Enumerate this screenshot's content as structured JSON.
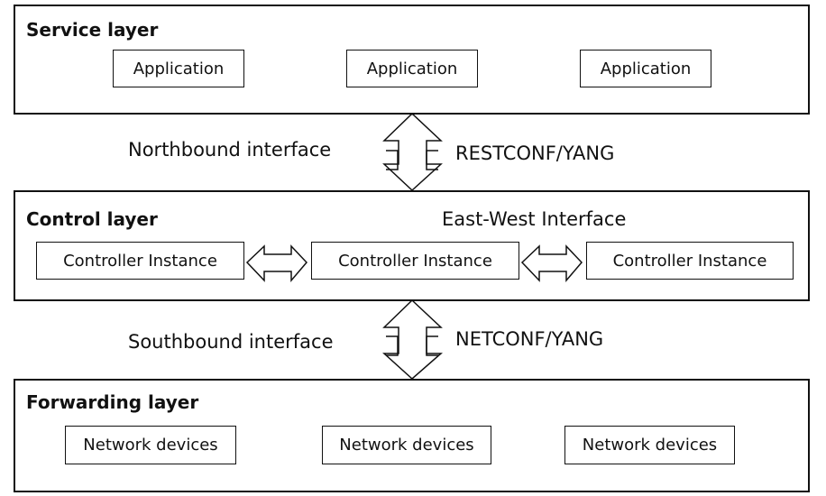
{
  "service_layer": {
    "title": "Service layer",
    "boxes": [
      "Application",
      "Application",
      "Application"
    ]
  },
  "northbound": {
    "label": "Northbound interface",
    "protocol": "RESTCONF/YANG"
  },
  "control_layer": {
    "title": "Control layer",
    "east_west": "East-West Interface",
    "boxes": [
      "Controller Instance",
      "Controller Instance",
      "Controller Instance"
    ]
  },
  "southbound": {
    "label": "Southbound interface",
    "protocol": "NETCONF/YANG"
  },
  "forwarding_layer": {
    "title": "Forwarding layer",
    "boxes": [
      "Network devices",
      "Network devices",
      "Network devices"
    ]
  }
}
